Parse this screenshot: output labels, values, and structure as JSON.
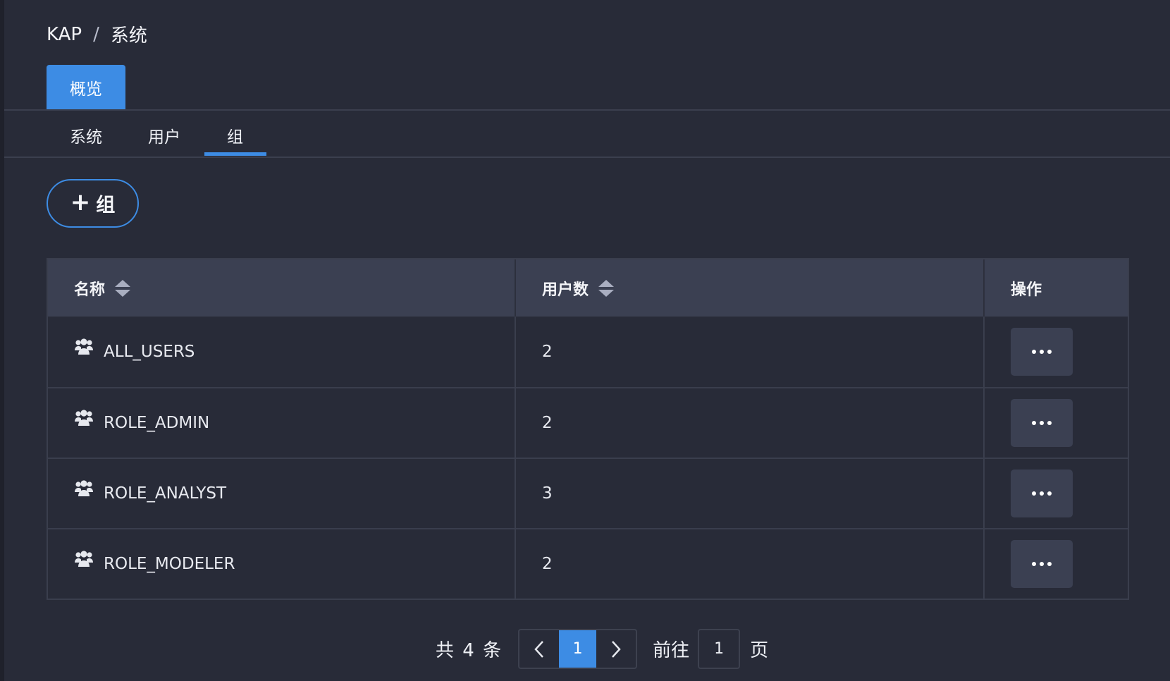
{
  "breadcrumb": {
    "root": "KAP",
    "separator": "/",
    "current": "系统"
  },
  "top_tab": {
    "label": "概览"
  },
  "sub_tabs": [
    {
      "label": "系统",
      "active": false
    },
    {
      "label": "用户",
      "active": false
    },
    {
      "label": "组",
      "active": true
    }
  ],
  "add_group_button": {
    "icon": "plus-icon",
    "label": "组"
  },
  "table": {
    "headers": {
      "name": "名称",
      "user_count": "用户数",
      "actions": "操作"
    },
    "rows": [
      {
        "name": "ALL_USERS",
        "user_count": "2",
        "icon": "group-icon"
      },
      {
        "name": "ROLE_ADMIN",
        "user_count": "2",
        "icon": "group-icon"
      },
      {
        "name": "ROLE_ANALYST",
        "user_count": "3",
        "icon": "group-icon"
      },
      {
        "name": "ROLE_MODELER",
        "user_count": "2",
        "icon": "group-icon"
      }
    ]
  },
  "pagination": {
    "total_text": "共 4 条",
    "current_page": "1",
    "goto_label": "前往",
    "goto_value": "1",
    "page_suffix": "页"
  },
  "colors": {
    "background": "#282b38",
    "accent": "#3d8ce4",
    "header_bg": "#3b4052"
  }
}
